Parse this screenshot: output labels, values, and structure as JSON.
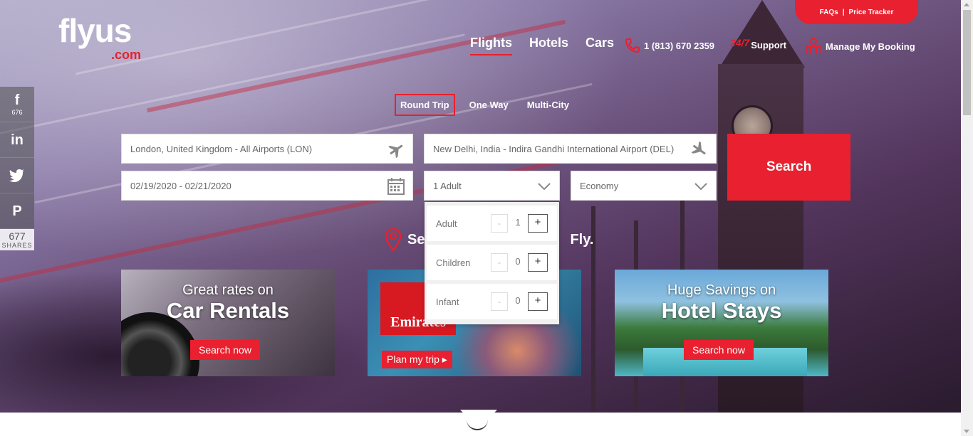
{
  "brand": {
    "logo_text": "flyus",
    "logo_suffix": ".com",
    "accent_color": "#e8202f"
  },
  "top_links": {
    "faqs": "FAQs",
    "separator": "|",
    "price_tracker": "Price Tracker"
  },
  "nav": {
    "flights": "Flights",
    "hotels": "Hotels",
    "cars": "Cars"
  },
  "utility": {
    "phone": "1 (813) 670 2359",
    "support_prefix": "24/7",
    "support": "Support",
    "manage_booking": "Manage My Booking"
  },
  "trip_types": [
    "Round Trip",
    "One Way",
    "Multi-City"
  ],
  "form": {
    "from_value": "London, United Kingdom - All Airports (LON)",
    "to_value": "New Delhi, India - Indira Gandhi International Airport (DEL)",
    "dates_value": "02/19/2020 - 02/21/2020",
    "travellers_value": "1 Adult",
    "cabin_value": "Economy",
    "search_label": "Search"
  },
  "passengers": [
    {
      "label": "Adult",
      "minus": "-",
      "count": "1",
      "plus": "+"
    },
    {
      "label": "Children",
      "minus": "-",
      "count": "0",
      "plus": "+"
    },
    {
      "label": "Infant",
      "minus": "-",
      "count": "0",
      "plus": "+"
    }
  ],
  "tagline": {
    "left": "Se",
    "right": "Fly."
  },
  "social": {
    "facebook_count": "676",
    "total_count": "677",
    "shares_label": "SHARES"
  },
  "ads": {
    "car": {
      "line1": "Great rates on",
      "line2": "Car Rentals",
      "cta": "Search now"
    },
    "emirates": {
      "brand": "Emirates",
      "cta": "Plan my trip ▸"
    },
    "hotel": {
      "line1": "Huge Savings on",
      "line2": "Hotel Stays",
      "cta": "Search now"
    }
  }
}
